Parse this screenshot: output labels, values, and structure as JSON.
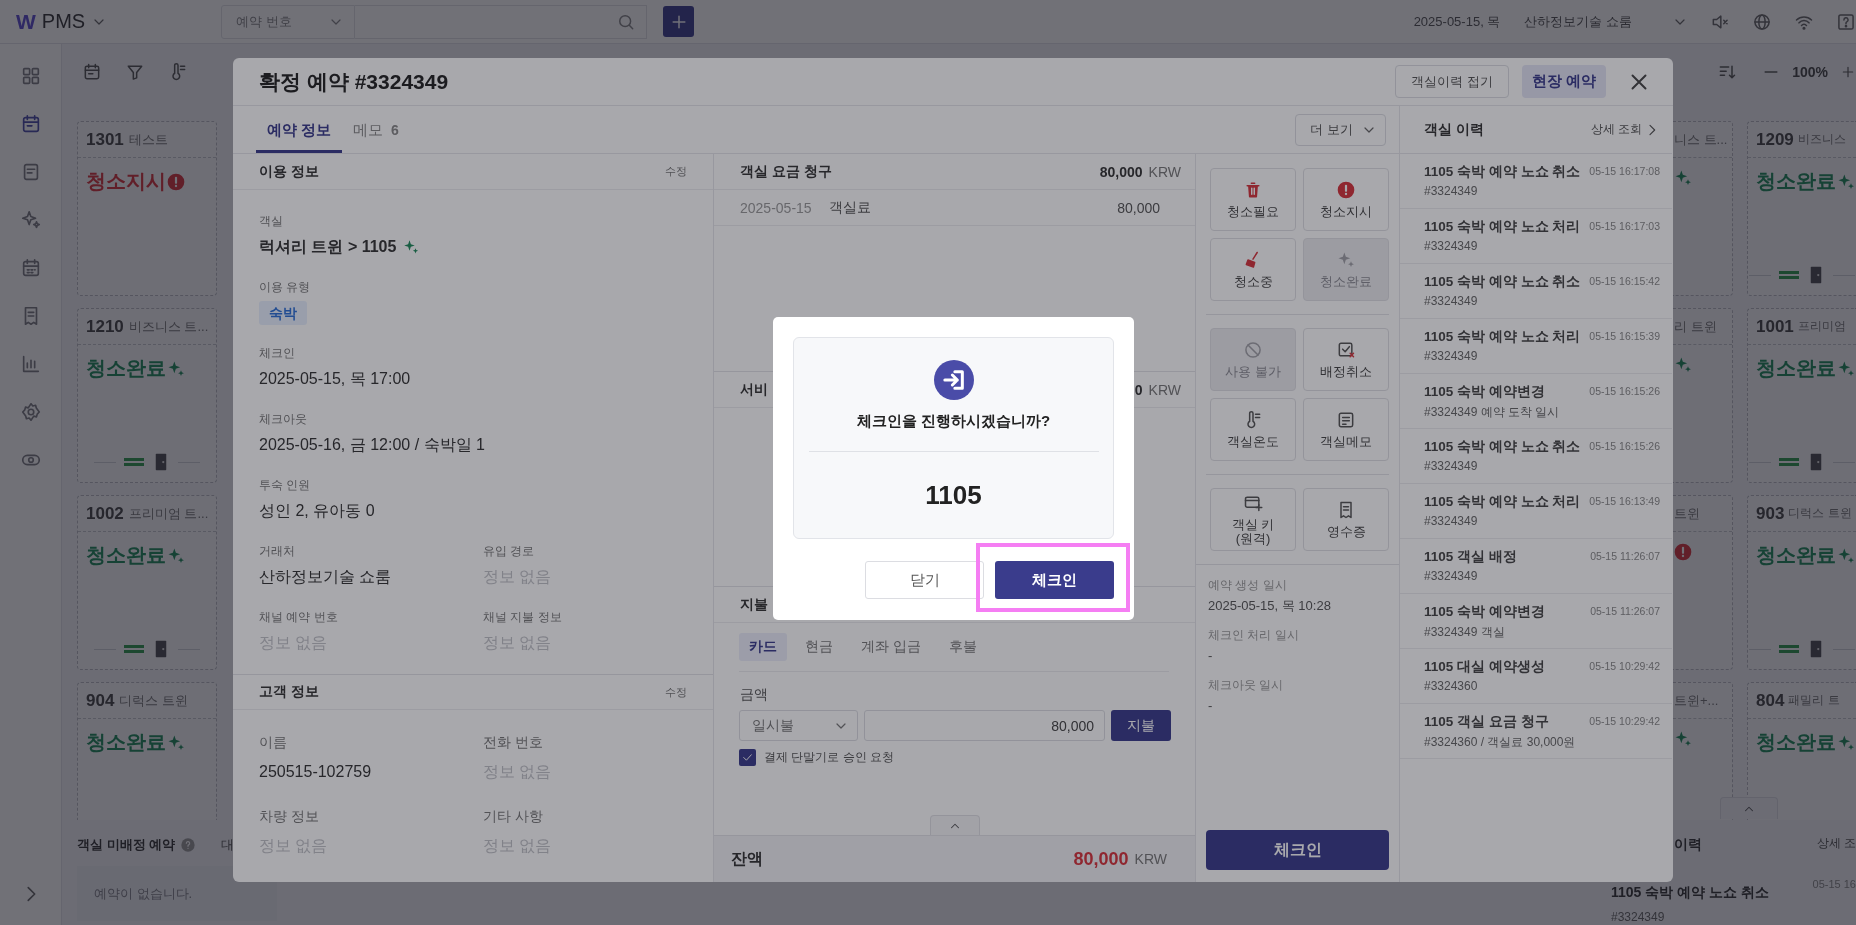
{
  "topbar": {
    "logo": "W",
    "app_name": "PMS",
    "search_type": "예약 번호",
    "date": "2025-05-15, 목",
    "property": "산하정보기술 쇼룸"
  },
  "sidebar": {
    "items": [
      {
        "selected": false
      },
      {
        "selected": true
      },
      {
        "selected": false
      },
      {
        "selected": false
      },
      {
        "selected": false
      },
      {
        "selected": false
      },
      {
        "selected": false
      },
      {
        "selected": false
      },
      {
        "selected": false
      }
    ]
  },
  "toolbar": {
    "zoom": "100%"
  },
  "rooms": [
    {
      "number": "1301",
      "type": "테스트",
      "status": "청소지시",
      "kind": "alert",
      "footer": false
    },
    {
      "number": "1210",
      "type": "비즈니스 트...",
      "status": "청소완료",
      "kind": "clean",
      "footer": true
    },
    {
      "number": "1002",
      "type": "프리미엄 트...",
      "status": "청소완료",
      "kind": "clean",
      "footer": true
    },
    {
      "number": "904",
      "type": "디럭스 트윈",
      "status": "청소완료",
      "kind": "clean"
    }
  ],
  "rooms_partial": [
    {
      "type": "니스 트...",
      "kind": "clean"
    },
    {
      "type": "리 트윈",
      "kind": "clean"
    },
    {
      "type": "트윈",
      "kind": "alert"
    },
    {
      "type": "트윈+...",
      "kind": "clean"
    }
  ],
  "rooms_right": [
    {
      "number": "1209",
      "type": "비즈니스",
      "status": "청소완료",
      "kind": "clean",
      "footer": true
    },
    {
      "number": "1001",
      "type": "프리미엄",
      "status": "청소완료",
      "kind": "clean",
      "footer": true
    },
    {
      "number": "903",
      "type": "디럭스 트윈",
      "status": "청소완료",
      "kind": "clean",
      "footer": true
    },
    {
      "number": "804",
      "type": "패밀리 트",
      "status": "청소완료",
      "kind": "clean"
    }
  ],
  "unassigned": {
    "title": "객실 미배정 예약",
    "tab": "대",
    "empty": "예약이 없습니다."
  },
  "history_panel": {
    "title": "이력",
    "link": "상세 조",
    "item": {
      "title": "1105 숙박 예약 노쇼 취소",
      "time": "05-15 16",
      "ref": "#3324349"
    }
  },
  "reservation": {
    "title": "확정 예약 #3324349",
    "header_buttons": [
      {
        "label": "객실이력 접기",
        "kind": "outline"
      },
      {
        "label": "현장 예약",
        "kind": "accent"
      }
    ],
    "tabs": [
      {
        "label": "예약 정보",
        "selected": true
      },
      {
        "label": "메모",
        "count": "6",
        "selected": false
      }
    ],
    "more": "더 보기",
    "usage": {
      "title": "이용 정보",
      "edit": "수정",
      "fields": [
        {
          "label": "객실",
          "value": "럭셔리 트윈 > 1105",
          "kind": "room"
        },
        {
          "label": "이용 유형",
          "value": "숙박",
          "kind": "tag"
        },
        {
          "label": "체크인",
          "value": "2025-05-15, 목 17:00",
          "kind": "text"
        },
        {
          "label": "체크아웃",
          "value": "2025-05-16, 금 12:00 / 숙박일 1",
          "kind": "text"
        },
        {
          "label": "투숙 인원",
          "value": "성인 2, 유아동 0",
          "kind": "text"
        }
      ],
      "pairs": [
        {
          "label": "거래처",
          "value": "산하정보기술 쇼룸",
          "empty": false
        },
        {
          "label": "유입 경로",
          "value": "정보 없음",
          "empty": true
        },
        {
          "label": "채널 예약 번호",
          "value": "정보 없음",
          "empty": true
        },
        {
          "label": "채널 지불 정보",
          "value": "정보 없음",
          "empty": true
        }
      ]
    },
    "guest": {
      "title": "고객 정보",
      "edit": "수정",
      "pairs": [
        {
          "label": "이름",
          "value": "250515-102759",
          "empty": false
        },
        {
          "label": "전화 번호",
          "value": "정보 없음",
          "empty": true
        },
        {
          "label": "차량 정보",
          "value": "정보 없음",
          "empty": true
        },
        {
          "label": "기타 사항",
          "value": "정보 없음",
          "empty": true
        }
      ]
    },
    "charges": {
      "title": "객실 요금 청구",
      "amount": "80,000",
      "currency": "KRW",
      "rows": [
        {
          "date": "2025-05-15",
          "item": "객실료",
          "amount": "80,000"
        }
      ]
    },
    "services": {
      "title": "서비",
      "amount": "0",
      "currency": "KRW"
    },
    "payment": {
      "title": "지불",
      "methods": [
        {
          "label": "카드",
          "selected": true
        },
        {
          "label": "현금",
          "selected": false
        },
        {
          "label": "계좌 입금",
          "selected": false
        },
        {
          "label": "후불",
          "selected": false
        }
      ],
      "amount_label": "금액",
      "plan": "일시불",
      "amount": "80,000",
      "pay_button": "지불",
      "terminal": {
        "label": "결제 단말기로 승인 요청",
        "checked": true
      }
    },
    "balance": {
      "label": "잔액",
      "amount": "80,000",
      "currency": "KRW"
    },
    "action_groups": [
      [
        {
          "label": "청소필요",
          "disabled": false
        },
        {
          "label": "청소지시",
          "disabled": false
        },
        {
          "label": "청소중",
          "disabled": false
        },
        {
          "label": "청소완료",
          "disabled": true
        }
      ],
      [
        {
          "label": "사용 불가",
          "disabled": true
        },
        {
          "label": "배정취소",
          "disabled": false
        },
        {
          "label": "객실온도",
          "disabled": false
        },
        {
          "label": "객실메모",
          "disabled": false
        }
      ],
      [
        {
          "label": "객실 키 (원격)",
          "disabled": false
        },
        {
          "label": "영수증",
          "disabled": false
        }
      ]
    ],
    "timestamps": [
      {
        "label": "예약 생성 일시",
        "value": "2025-05-15, 목 10:28"
      },
      {
        "label": "체크인 처리 일시",
        "value": "-"
      },
      {
        "label": "체크아웃 일시",
        "value": "-"
      }
    ],
    "checkin_button": "체크인",
    "history": {
      "title": "객실 이력",
      "link": "상세 조회",
      "items": [
        {
          "title": "1105 숙박 예약 노쇼 취소",
          "time": "05-15 16:17:08",
          "ref": "#3324349"
        },
        {
          "title": "1105 숙박 예약 노쇼 처리",
          "time": "05-15 16:17:03",
          "ref": "#3324349"
        },
        {
          "title": "1105 숙박 예약 노쇼 취소",
          "time": "05-15 16:15:42",
          "ref": "#3324349"
        },
        {
          "title": "1105 숙박 예약 노쇼 처리",
          "time": "05-15 16:15:39",
          "ref": "#3324349"
        },
        {
          "title": "1105 숙박 예약변경",
          "time": "05-15 16:15:26",
          "ref": "#3324349 예약 도착 일시"
        },
        {
          "title": "1105 숙박 예약 노쇼 취소",
          "time": "05-15 16:15:26",
          "ref": "#3324349"
        },
        {
          "title": "1105 숙박 예약 노쇼 처리",
          "time": "05-15 16:13:49",
          "ref": "#3324349"
        },
        {
          "title": "1105 객실 배정",
          "time": "05-15 11:26:07",
          "ref": "#3324349"
        },
        {
          "title": "1105 숙박 예약변경",
          "time": "05-15 11:26:07",
          "ref": "#3324349 객실"
        },
        {
          "title": "1105 대실 예약생성",
          "time": "05-15 10:29:42",
          "ref": "#3324360"
        },
        {
          "title": "1105 객실 요금 청구",
          "time": "05-15 10:29:42",
          "ref": "#3324360 / 객실료 30,000원"
        }
      ]
    }
  },
  "confirm": {
    "message": "체크인을 진행하시겠습니까?",
    "room": "1105",
    "buttons": [
      {
        "label": "닫기",
        "kind": "secondary",
        "highlighted": false
      },
      {
        "label": "체크인",
        "kind": "primary",
        "highlighted": true
      }
    ]
  }
}
